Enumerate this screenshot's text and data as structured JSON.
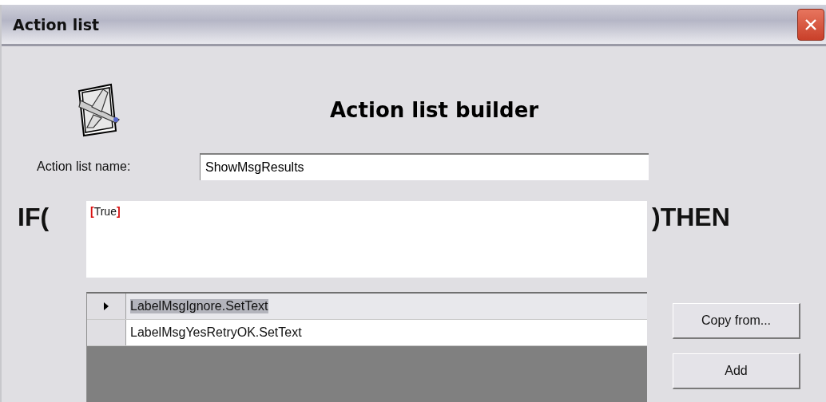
{
  "window": {
    "title": "Action list"
  },
  "heading": "Action list builder",
  "name_field": {
    "label": "Action list name:",
    "value": "ShowMsgResults"
  },
  "condition": {
    "prefix": "IF(",
    "suffix": ")THEN",
    "tokens": [
      {
        "kind": "bracket",
        "text": "["
      },
      {
        "kind": "value",
        "text": "True"
      },
      {
        "kind": "bracket",
        "text": "]"
      }
    ]
  },
  "actions": {
    "rows": [
      {
        "text": "LabelMsgIgnore.SetText",
        "selected": true
      },
      {
        "text": "LabelMsgYesRetryOK.SetText",
        "selected": false
      }
    ]
  },
  "buttons": [
    {
      "label": "Copy from..."
    },
    {
      "label": "Add"
    }
  ]
}
